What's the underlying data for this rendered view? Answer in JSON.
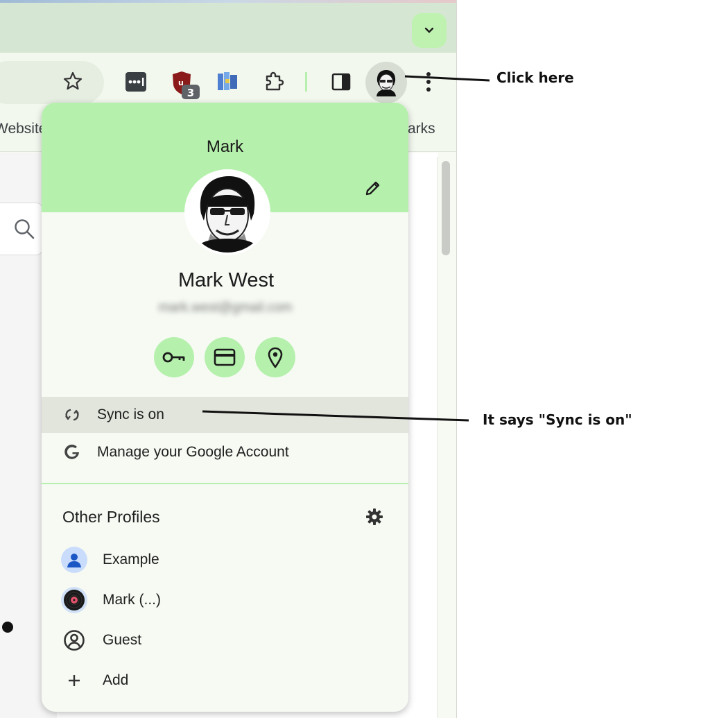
{
  "bookmarks": {
    "left_label": "Website",
    "right_label": "arks"
  },
  "profile_menu": {
    "header_name": "Mark",
    "full_name": "Mark West",
    "email": "mark.west@gmail.com",
    "quick_actions": [
      {
        "name": "passwords",
        "icon": "key-icon"
      },
      {
        "name": "payment-methods",
        "icon": "credit-card-icon"
      },
      {
        "name": "addresses",
        "icon": "location-pin-icon"
      }
    ],
    "sync_label": "Sync is on",
    "manage_label": "Manage your Google Account",
    "other_profiles_title": "Other Profiles",
    "profiles": [
      {
        "label": "Example",
        "icon": "person-avatar-icon"
      },
      {
        "label": "Mark (...)",
        "icon": "vinyl-record-avatar-icon"
      },
      {
        "label": "Guest",
        "icon": "guest-icon"
      },
      {
        "label": "Add",
        "icon": "plus-icon"
      }
    ]
  },
  "toolbar": {
    "extension_badge_count": "3"
  },
  "annotations": {
    "click_here": "Click here",
    "sync_note": "It says \"Sync is on\""
  },
  "colors": {
    "accent_green": "#b5f0ac",
    "panel_background": "#f6faf3",
    "sync_row_highlight": "#e2e5dc"
  }
}
